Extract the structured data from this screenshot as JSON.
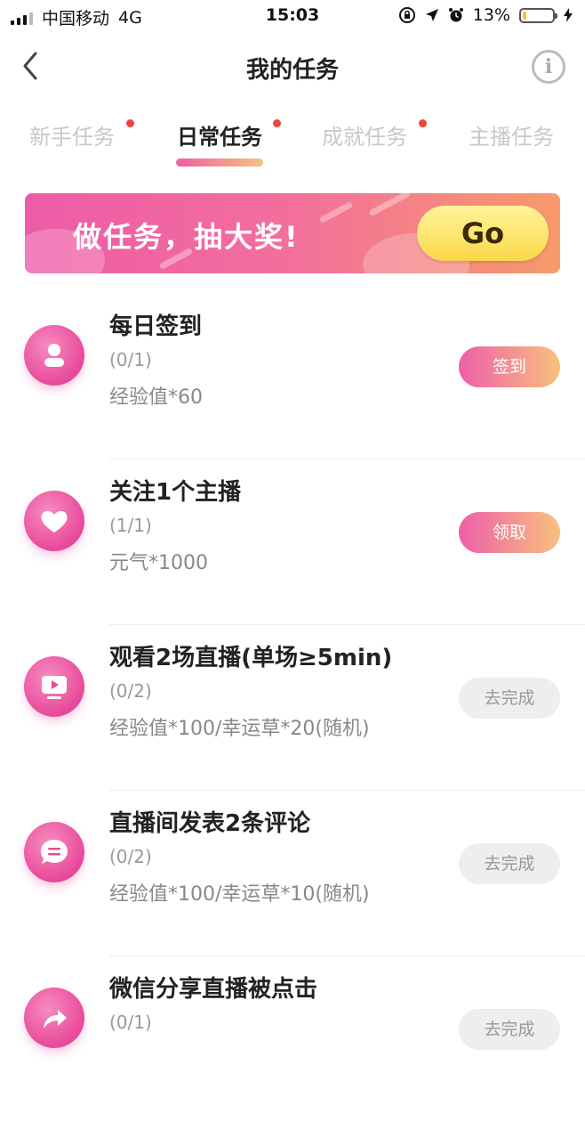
{
  "status_bar": {
    "carrier": "中国移动",
    "network": "4G",
    "time": "15:03",
    "battery": "13%"
  },
  "nav": {
    "title": "我的任务",
    "info_icon": "i"
  },
  "tabs": [
    {
      "label": "新手任务",
      "has_dot": true,
      "active": false
    },
    {
      "label": "日常任务",
      "has_dot": true,
      "active": true
    },
    {
      "label": "成就任务",
      "has_dot": true,
      "active": false
    },
    {
      "label": "主播任务",
      "has_dot": false,
      "active": false
    }
  ],
  "banner": {
    "text": "做任务，抽大奖!",
    "button": "Go"
  },
  "tasks": [
    {
      "title": "每日签到",
      "progress": "(0/1)",
      "reward": "经验值*60",
      "button": "签到",
      "button_style": "primary",
      "icon": "user-icon"
    },
    {
      "title": "关注1个主播",
      "progress": "(1/1)",
      "reward": "元气*1000",
      "button": "领取",
      "button_style": "primary",
      "icon": "heart-icon"
    },
    {
      "title": "观看2场直播(单场≥5min)",
      "progress": "(0/2)",
      "reward": "经验值*100/幸运草*20(随机)",
      "button": "去完成",
      "button_style": "muted",
      "icon": "tv-play-icon"
    },
    {
      "title": "直播间发表2条评论",
      "progress": "(0/2)",
      "reward": "经验值*100/幸运草*10(随机)",
      "button": "去完成",
      "button_style": "muted",
      "icon": "comment-icon"
    },
    {
      "title": "微信分享直播被点击",
      "progress": "(0/1)",
      "reward": "",
      "button": "去完成",
      "button_style": "muted",
      "icon": "share-icon"
    }
  ],
  "colors": {
    "accent_pink": "#ee5fa8",
    "accent_orange": "#f8c17d",
    "red_dot": "#f0453a",
    "go_yellow": "#fbd84a"
  }
}
